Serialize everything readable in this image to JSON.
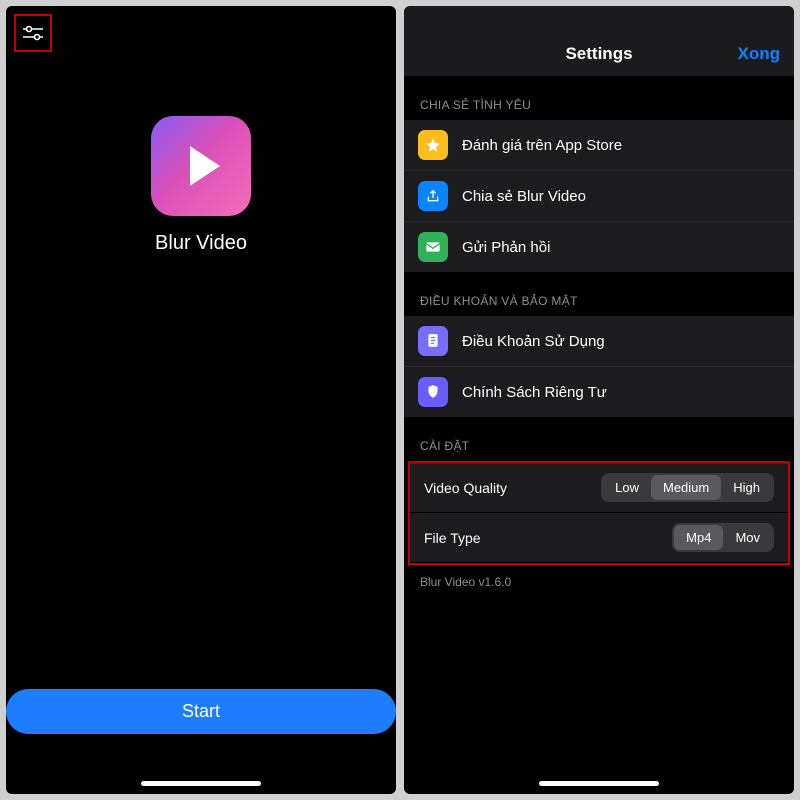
{
  "left": {
    "app_name": "Blur Video",
    "start_label": "Start"
  },
  "right": {
    "title": "Settings",
    "done": "Xong",
    "section_share": "CHIA SẺ TÌNH YÊU",
    "rate_label": "Đánh giá trên App Store",
    "share_label": "Chia sẻ Blur Video",
    "feedback_label": "Gửi Phản hồi",
    "section_terms": "ĐIỀU KHOẢN VÀ BẢO MẬT",
    "terms_label": "Điều Khoản Sử Dụng",
    "privacy_label": "Chính Sách Riêng Tư",
    "section_settings": "CÀI ĐẶT",
    "quality_label": "Video Quality",
    "quality_options": {
      "low": "Low",
      "medium": "Medium",
      "high": "High"
    },
    "filetype_label": "File Type",
    "filetype_options": {
      "mp4": "Mp4",
      "mov": "Mov"
    },
    "version": "Blur Video v1.6.0"
  }
}
